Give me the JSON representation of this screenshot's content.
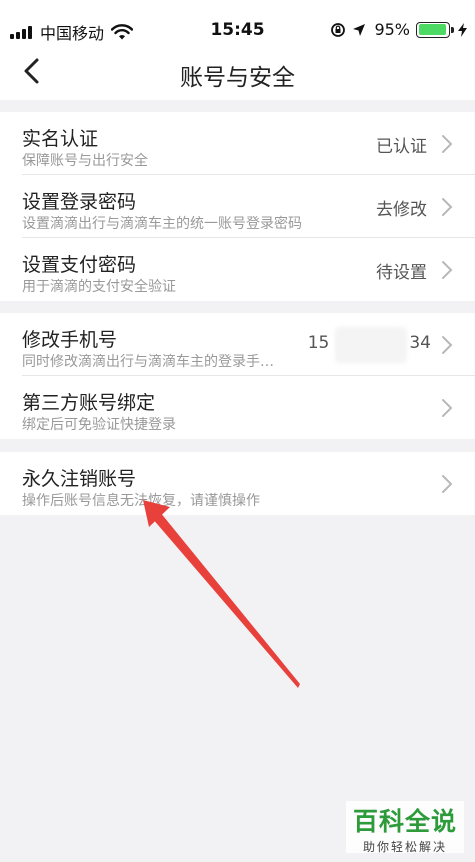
{
  "status_bar": {
    "carrier": "中国移动",
    "time": "15:45",
    "battery": "95%",
    "battery_level": 0.95
  },
  "nav": {
    "title": "账号与安全"
  },
  "groups": [
    {
      "rows": [
        {
          "title": "实名认证",
          "subtitle": "保障账号与出行安全",
          "value": "已认证"
        },
        {
          "title": "设置登录密码",
          "subtitle": "设置滴滴出行与滴滴车主的统一账号登录密码",
          "value": "去修改"
        },
        {
          "title": "设置支付密码",
          "subtitle": "用于滴滴的支付安全验证",
          "value": "待设置"
        }
      ]
    },
    {
      "rows": [
        {
          "title": "修改手机号",
          "subtitle": "同时修改滴滴出行与滴滴车主的登录手…",
          "value_prefix": "15",
          "value_suffix": "34"
        },
        {
          "title": "第三方账号绑定",
          "subtitle": "绑定后可免验证快捷登录"
        }
      ]
    },
    {
      "rows": [
        {
          "title": "永久注销账号",
          "subtitle": "操作后账号信息无法恢复，请谨慎操作"
        }
      ]
    }
  ],
  "watermark": {
    "main": "百科全说",
    "sub": "助你轻松解决"
  },
  "colors": {
    "accent_red": "#e8413c",
    "battery_green": "#4cd964",
    "watermark_green": "#2e9b3b"
  }
}
